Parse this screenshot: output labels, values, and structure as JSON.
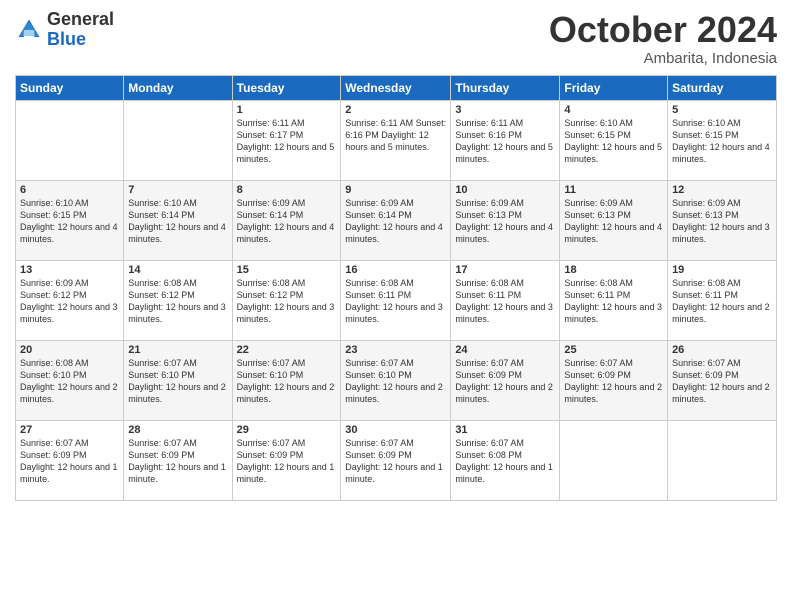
{
  "logo": {
    "general": "General",
    "blue": "Blue"
  },
  "title": "October 2024",
  "location": "Ambarita, Indonesia",
  "weekdays": [
    "Sunday",
    "Monday",
    "Tuesday",
    "Wednesday",
    "Thursday",
    "Friday",
    "Saturday"
  ],
  "weeks": [
    [
      {
        "day": "",
        "info": ""
      },
      {
        "day": "",
        "info": ""
      },
      {
        "day": "1",
        "info": "Sunrise: 6:11 AM\nSunset: 6:17 PM\nDaylight: 12 hours\nand 5 minutes."
      },
      {
        "day": "2",
        "info": "Sunrise: 6:11 AM\nSunset: 6:16 PM\nDaylight: 12 hours\nand 5 minutes."
      },
      {
        "day": "3",
        "info": "Sunrise: 6:11 AM\nSunset: 6:16 PM\nDaylight: 12 hours\nand 5 minutes."
      },
      {
        "day": "4",
        "info": "Sunrise: 6:10 AM\nSunset: 6:15 PM\nDaylight: 12 hours\nand 5 minutes."
      },
      {
        "day": "5",
        "info": "Sunrise: 6:10 AM\nSunset: 6:15 PM\nDaylight: 12 hours\nand 4 minutes."
      }
    ],
    [
      {
        "day": "6",
        "info": "Sunrise: 6:10 AM\nSunset: 6:15 PM\nDaylight: 12 hours\nand 4 minutes."
      },
      {
        "day": "7",
        "info": "Sunrise: 6:10 AM\nSunset: 6:14 PM\nDaylight: 12 hours\nand 4 minutes."
      },
      {
        "day": "8",
        "info": "Sunrise: 6:09 AM\nSunset: 6:14 PM\nDaylight: 12 hours\nand 4 minutes."
      },
      {
        "day": "9",
        "info": "Sunrise: 6:09 AM\nSunset: 6:14 PM\nDaylight: 12 hours\nand 4 minutes."
      },
      {
        "day": "10",
        "info": "Sunrise: 6:09 AM\nSunset: 6:13 PM\nDaylight: 12 hours\nand 4 minutes."
      },
      {
        "day": "11",
        "info": "Sunrise: 6:09 AM\nSunset: 6:13 PM\nDaylight: 12 hours\nand 4 minutes."
      },
      {
        "day": "12",
        "info": "Sunrise: 6:09 AM\nSunset: 6:13 PM\nDaylight: 12 hours\nand 3 minutes."
      }
    ],
    [
      {
        "day": "13",
        "info": "Sunrise: 6:09 AM\nSunset: 6:12 PM\nDaylight: 12 hours\nand 3 minutes."
      },
      {
        "day": "14",
        "info": "Sunrise: 6:08 AM\nSunset: 6:12 PM\nDaylight: 12 hours\nand 3 minutes."
      },
      {
        "day": "15",
        "info": "Sunrise: 6:08 AM\nSunset: 6:12 PM\nDaylight: 12 hours\nand 3 minutes."
      },
      {
        "day": "16",
        "info": "Sunrise: 6:08 AM\nSunset: 6:11 PM\nDaylight: 12 hours\nand 3 minutes."
      },
      {
        "day": "17",
        "info": "Sunrise: 6:08 AM\nSunset: 6:11 PM\nDaylight: 12 hours\nand 3 minutes."
      },
      {
        "day": "18",
        "info": "Sunrise: 6:08 AM\nSunset: 6:11 PM\nDaylight: 12 hours\nand 3 minutes."
      },
      {
        "day": "19",
        "info": "Sunrise: 6:08 AM\nSunset: 6:11 PM\nDaylight: 12 hours\nand 2 minutes."
      }
    ],
    [
      {
        "day": "20",
        "info": "Sunrise: 6:08 AM\nSunset: 6:10 PM\nDaylight: 12 hours\nand 2 minutes."
      },
      {
        "day": "21",
        "info": "Sunrise: 6:07 AM\nSunset: 6:10 PM\nDaylight: 12 hours\nand 2 minutes."
      },
      {
        "day": "22",
        "info": "Sunrise: 6:07 AM\nSunset: 6:10 PM\nDaylight: 12 hours\nand 2 minutes."
      },
      {
        "day": "23",
        "info": "Sunrise: 6:07 AM\nSunset: 6:10 PM\nDaylight: 12 hours\nand 2 minutes."
      },
      {
        "day": "24",
        "info": "Sunrise: 6:07 AM\nSunset: 6:09 PM\nDaylight: 12 hours\nand 2 minutes."
      },
      {
        "day": "25",
        "info": "Sunrise: 6:07 AM\nSunset: 6:09 PM\nDaylight: 12 hours\nand 2 minutes."
      },
      {
        "day": "26",
        "info": "Sunrise: 6:07 AM\nSunset: 6:09 PM\nDaylight: 12 hours\nand 2 minutes."
      }
    ],
    [
      {
        "day": "27",
        "info": "Sunrise: 6:07 AM\nSunset: 6:09 PM\nDaylight: 12 hours\nand 1 minute."
      },
      {
        "day": "28",
        "info": "Sunrise: 6:07 AM\nSunset: 6:09 PM\nDaylight: 12 hours\nand 1 minute."
      },
      {
        "day": "29",
        "info": "Sunrise: 6:07 AM\nSunset: 6:09 PM\nDaylight: 12 hours\nand 1 minute."
      },
      {
        "day": "30",
        "info": "Sunrise: 6:07 AM\nSunset: 6:09 PM\nDaylight: 12 hours\nand 1 minute."
      },
      {
        "day": "31",
        "info": "Sunrise: 6:07 AM\nSunset: 6:08 PM\nDaylight: 12 hours\nand 1 minute."
      },
      {
        "day": "",
        "info": ""
      },
      {
        "day": "",
        "info": ""
      }
    ]
  ]
}
